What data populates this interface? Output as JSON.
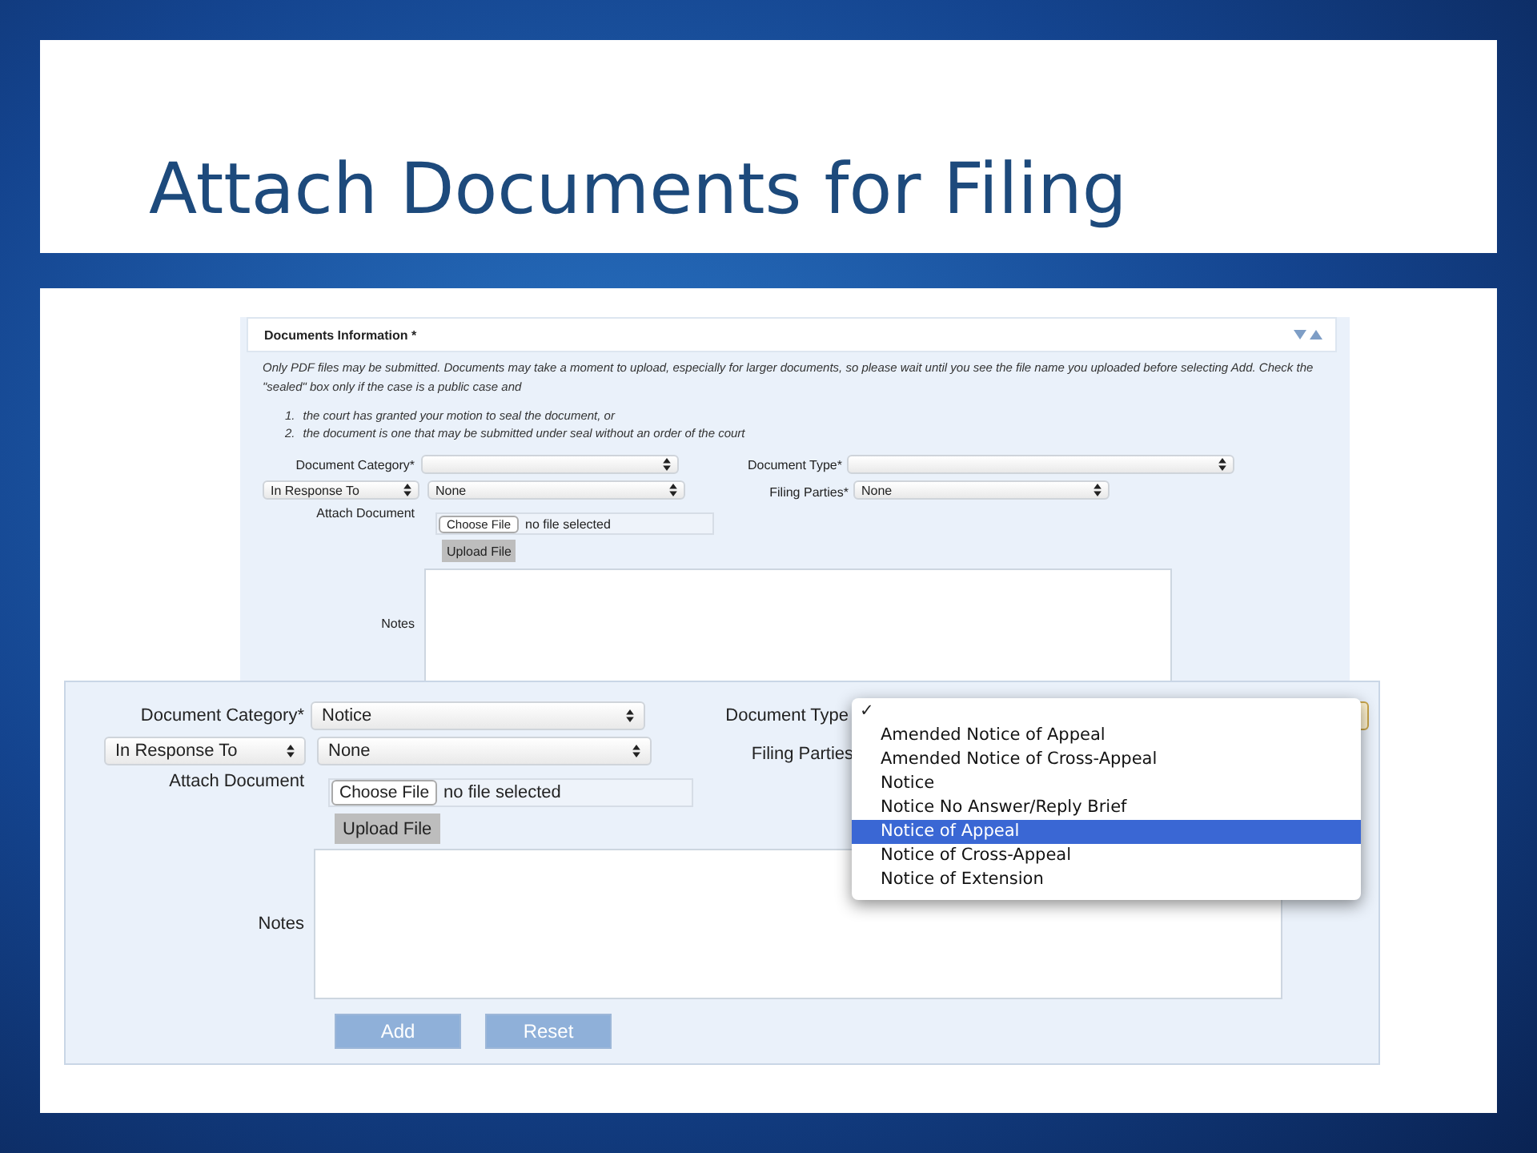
{
  "slide": {
    "title": "Attach Documents for Filing"
  },
  "back_form": {
    "section_title": "Documents Information *",
    "collapsed": false,
    "intro": "Only PDF files may be submitted. Documents may take a moment to upload, especially for larger documents, so please wait until you see the file name you uploaded before selecting Add. Check the \"sealed\" box only if the case is a public case and",
    "conditions": [
      {
        "number": "1.",
        "text": "the court has granted your motion to seal the document, or"
      },
      {
        "number": "2.",
        "text": "the document is one that may be submitted under seal without an order of the court"
      }
    ],
    "document_category": {
      "label": "Document Category*"
    },
    "document_type": {
      "label": "Document Type*"
    },
    "response_mode": {
      "value": "In Response To"
    },
    "response_to": {
      "value": "None"
    },
    "filing_parties": {
      "label": "Filing Parties*",
      "value": "None"
    },
    "attach": {
      "label": "Attach Document",
      "button": "Choose File",
      "status": "no file selected",
      "upload": "Upload File"
    },
    "notes": {
      "label": "Notes"
    }
  },
  "front_form": {
    "document_category": {
      "label": "Document Category*",
      "value": "Notice"
    },
    "document_type": {
      "label": "Document Type"
    },
    "response_mode": {
      "value": "In Response To"
    },
    "response_to": {
      "value": "None"
    },
    "filing_parties": {
      "label": "Filing Parties"
    },
    "attach": {
      "label": "Attach Document",
      "button": "Choose File",
      "status": "no file selected",
      "upload": "Upload File"
    },
    "notes": {
      "label": "Notes"
    },
    "buttons": [
      "Add",
      "Reset"
    ],
    "type_menu": {
      "check_mark": "✓",
      "options": [
        {
          "label": "Amended Notice of Appeal",
          "selected": false
        },
        {
          "label": "Amended Notice of Cross-Appeal",
          "selected": false
        },
        {
          "label": "Notice",
          "selected": false
        },
        {
          "label": "Notice No Answer/Reply Brief",
          "selected": false
        },
        {
          "label": "Notice of Appeal",
          "selected": true
        },
        {
          "label": "Notice of Cross-Appeal",
          "selected": false
        },
        {
          "label": "Notice of Extension",
          "selected": false
        }
      ]
    }
  }
}
